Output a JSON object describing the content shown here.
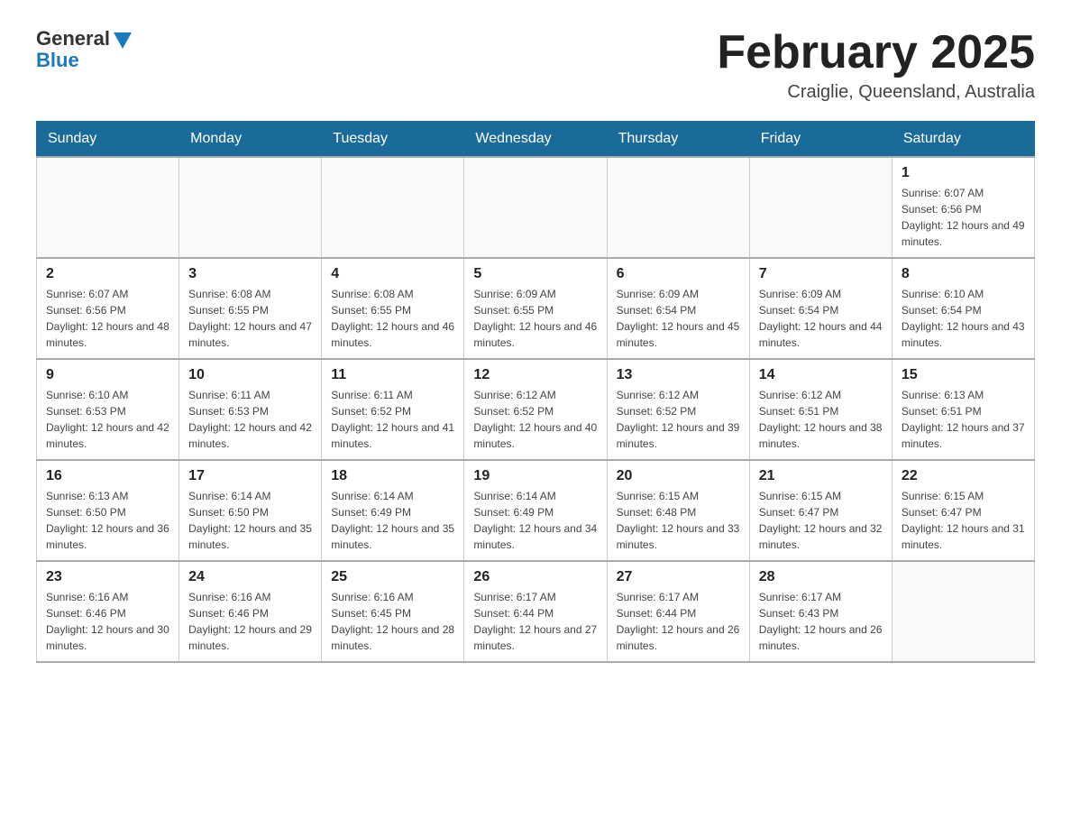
{
  "header": {
    "logo_general": "General",
    "logo_blue": "Blue",
    "month_title": "February 2025",
    "location": "Craiglie, Queensland, Australia"
  },
  "days_of_week": [
    "Sunday",
    "Monday",
    "Tuesday",
    "Wednesday",
    "Thursday",
    "Friday",
    "Saturday"
  ],
  "weeks": [
    [
      {
        "day": "",
        "info": ""
      },
      {
        "day": "",
        "info": ""
      },
      {
        "day": "",
        "info": ""
      },
      {
        "day": "",
        "info": ""
      },
      {
        "day": "",
        "info": ""
      },
      {
        "day": "",
        "info": ""
      },
      {
        "day": "1",
        "info": "Sunrise: 6:07 AM\nSunset: 6:56 PM\nDaylight: 12 hours and 49 minutes."
      }
    ],
    [
      {
        "day": "2",
        "info": "Sunrise: 6:07 AM\nSunset: 6:56 PM\nDaylight: 12 hours and 48 minutes."
      },
      {
        "day": "3",
        "info": "Sunrise: 6:08 AM\nSunset: 6:55 PM\nDaylight: 12 hours and 47 minutes."
      },
      {
        "day": "4",
        "info": "Sunrise: 6:08 AM\nSunset: 6:55 PM\nDaylight: 12 hours and 46 minutes."
      },
      {
        "day": "5",
        "info": "Sunrise: 6:09 AM\nSunset: 6:55 PM\nDaylight: 12 hours and 46 minutes."
      },
      {
        "day": "6",
        "info": "Sunrise: 6:09 AM\nSunset: 6:54 PM\nDaylight: 12 hours and 45 minutes."
      },
      {
        "day": "7",
        "info": "Sunrise: 6:09 AM\nSunset: 6:54 PM\nDaylight: 12 hours and 44 minutes."
      },
      {
        "day": "8",
        "info": "Sunrise: 6:10 AM\nSunset: 6:54 PM\nDaylight: 12 hours and 43 minutes."
      }
    ],
    [
      {
        "day": "9",
        "info": "Sunrise: 6:10 AM\nSunset: 6:53 PM\nDaylight: 12 hours and 42 minutes."
      },
      {
        "day": "10",
        "info": "Sunrise: 6:11 AM\nSunset: 6:53 PM\nDaylight: 12 hours and 42 minutes."
      },
      {
        "day": "11",
        "info": "Sunrise: 6:11 AM\nSunset: 6:52 PM\nDaylight: 12 hours and 41 minutes."
      },
      {
        "day": "12",
        "info": "Sunrise: 6:12 AM\nSunset: 6:52 PM\nDaylight: 12 hours and 40 minutes."
      },
      {
        "day": "13",
        "info": "Sunrise: 6:12 AM\nSunset: 6:52 PM\nDaylight: 12 hours and 39 minutes."
      },
      {
        "day": "14",
        "info": "Sunrise: 6:12 AM\nSunset: 6:51 PM\nDaylight: 12 hours and 38 minutes."
      },
      {
        "day": "15",
        "info": "Sunrise: 6:13 AM\nSunset: 6:51 PM\nDaylight: 12 hours and 37 minutes."
      }
    ],
    [
      {
        "day": "16",
        "info": "Sunrise: 6:13 AM\nSunset: 6:50 PM\nDaylight: 12 hours and 36 minutes."
      },
      {
        "day": "17",
        "info": "Sunrise: 6:14 AM\nSunset: 6:50 PM\nDaylight: 12 hours and 35 minutes."
      },
      {
        "day": "18",
        "info": "Sunrise: 6:14 AM\nSunset: 6:49 PM\nDaylight: 12 hours and 35 minutes."
      },
      {
        "day": "19",
        "info": "Sunrise: 6:14 AM\nSunset: 6:49 PM\nDaylight: 12 hours and 34 minutes."
      },
      {
        "day": "20",
        "info": "Sunrise: 6:15 AM\nSunset: 6:48 PM\nDaylight: 12 hours and 33 minutes."
      },
      {
        "day": "21",
        "info": "Sunrise: 6:15 AM\nSunset: 6:47 PM\nDaylight: 12 hours and 32 minutes."
      },
      {
        "day": "22",
        "info": "Sunrise: 6:15 AM\nSunset: 6:47 PM\nDaylight: 12 hours and 31 minutes."
      }
    ],
    [
      {
        "day": "23",
        "info": "Sunrise: 6:16 AM\nSunset: 6:46 PM\nDaylight: 12 hours and 30 minutes."
      },
      {
        "day": "24",
        "info": "Sunrise: 6:16 AM\nSunset: 6:46 PM\nDaylight: 12 hours and 29 minutes."
      },
      {
        "day": "25",
        "info": "Sunrise: 6:16 AM\nSunset: 6:45 PM\nDaylight: 12 hours and 28 minutes."
      },
      {
        "day": "26",
        "info": "Sunrise: 6:17 AM\nSunset: 6:44 PM\nDaylight: 12 hours and 27 minutes."
      },
      {
        "day": "27",
        "info": "Sunrise: 6:17 AM\nSunset: 6:44 PM\nDaylight: 12 hours and 26 minutes."
      },
      {
        "day": "28",
        "info": "Sunrise: 6:17 AM\nSunset: 6:43 PM\nDaylight: 12 hours and 26 minutes."
      },
      {
        "day": "",
        "info": ""
      }
    ]
  ]
}
